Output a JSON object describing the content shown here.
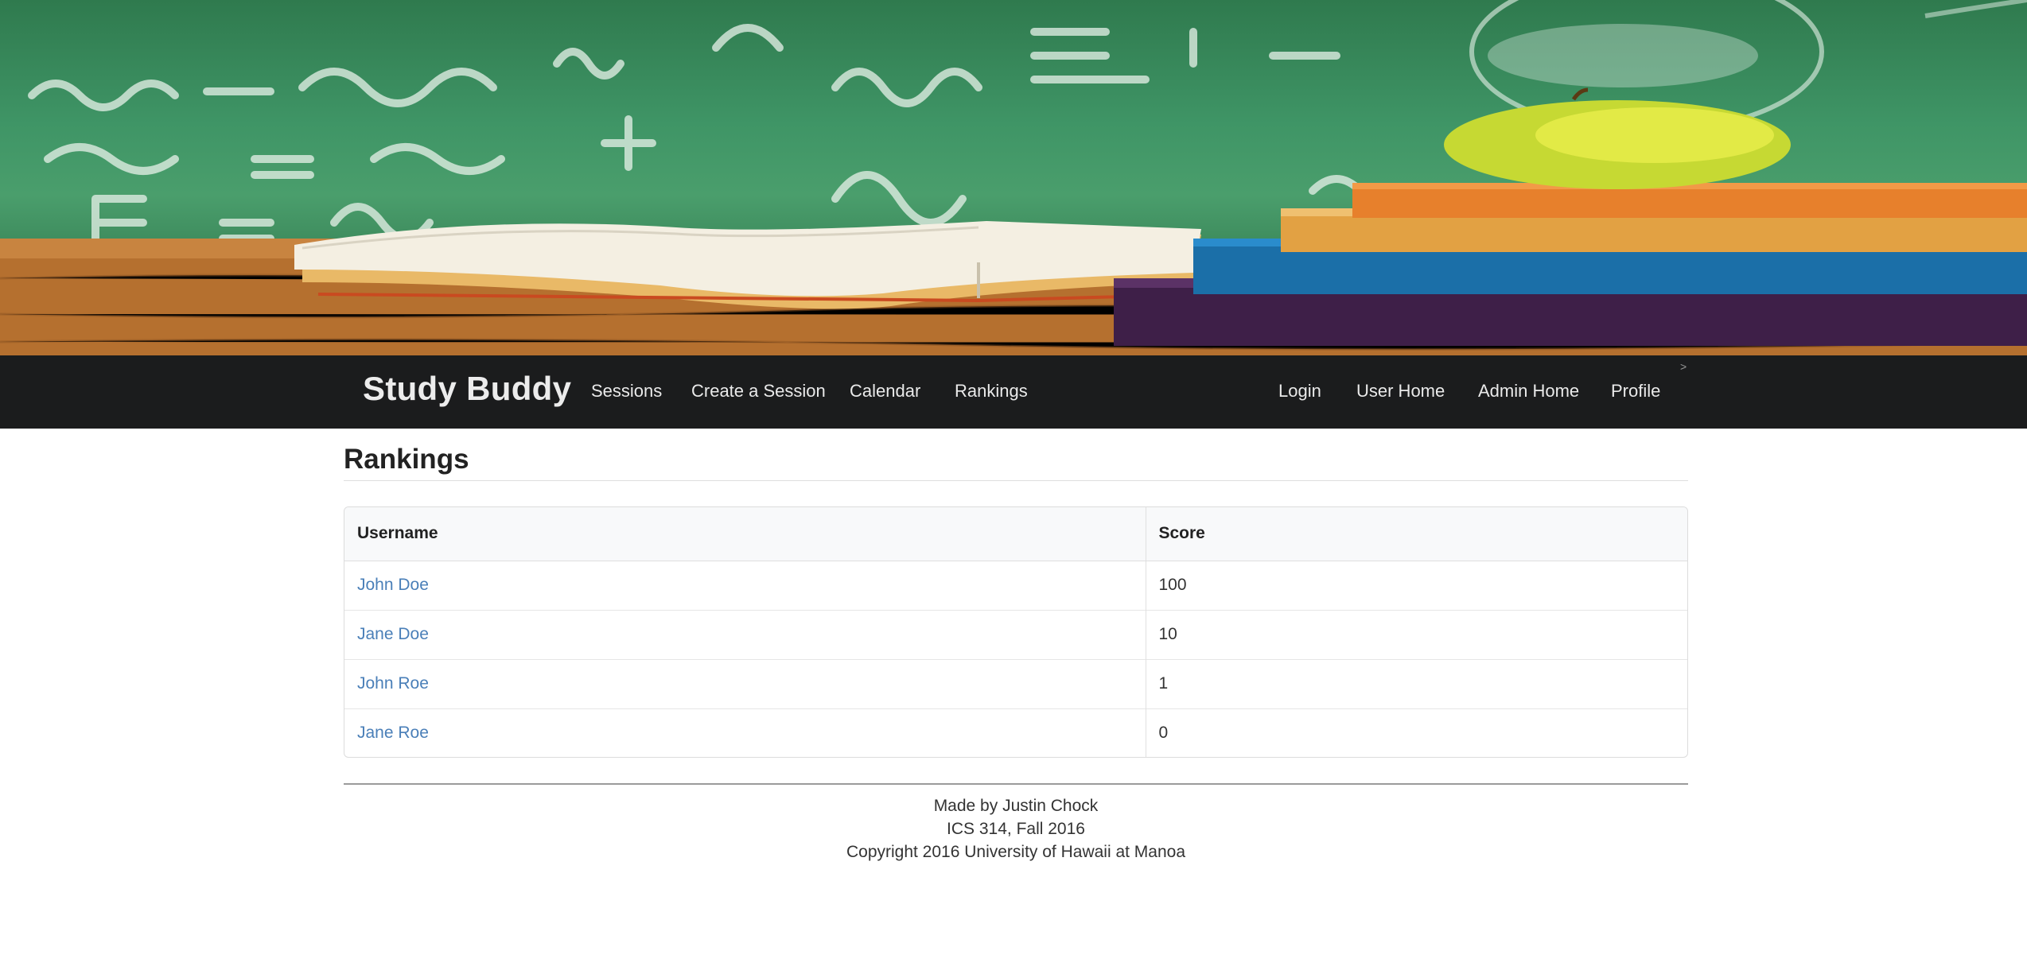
{
  "navbar": {
    "brand": "Study Buddy",
    "left_items": [
      {
        "label": "Sessions"
      },
      {
        "label": "Create a Session"
      },
      {
        "label": "Calendar"
      },
      {
        "label": "Rankings"
      }
    ],
    "right_items": [
      {
        "label": "Login"
      },
      {
        "label": "User Home"
      },
      {
        "label": "Admin Home"
      },
      {
        "label": "Profile"
      }
    ],
    "caret_glyph": ">"
  },
  "page": {
    "title": "Rankings"
  },
  "table": {
    "columns": [
      "Username",
      "Score"
    ],
    "rows": [
      {
        "username": "John Doe",
        "score": "100"
      },
      {
        "username": "Jane Doe",
        "score": "10"
      },
      {
        "username": "John Roe",
        "score": "1"
      },
      {
        "username": "Jane Roe",
        "score": "0"
      }
    ]
  },
  "footer": {
    "lines": [
      "Made by Justin Chock",
      "ICS 314, Fall 2016",
      "Copyright 2016 University of Hawaii at Manoa"
    ]
  },
  "colors": {
    "navbar_bg": "#1b1c1d",
    "link": "#4a7fb8",
    "chalkboard": "#3f9566"
  }
}
